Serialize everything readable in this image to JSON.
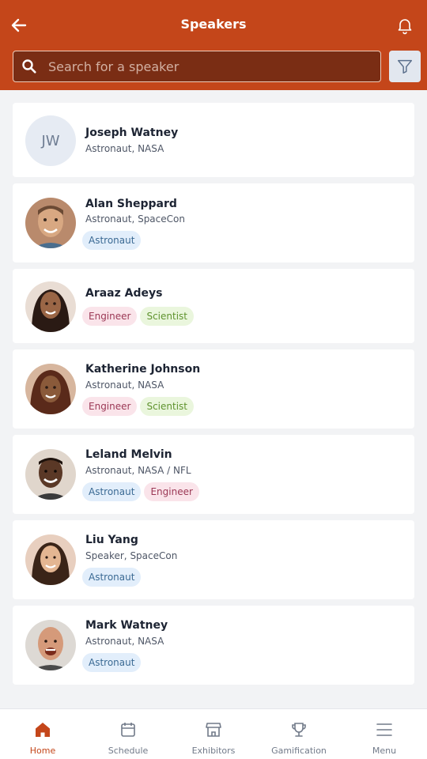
{
  "header": {
    "title": "Speakers"
  },
  "search": {
    "placeholder": "Search for a speaker",
    "value": ""
  },
  "colors": {
    "brand": "#c4461a",
    "astronaut": "#3b6a94",
    "engineer": "#9b3855",
    "scientist": "#5f932e"
  },
  "speakers": [
    {
      "name": "Joseph Watney",
      "role": "Astronaut, NASA",
      "initials": "JW",
      "tags": []
    },
    {
      "name": "Alan Sheppard",
      "role": "Astronaut, SpaceCon",
      "tags": [
        "Astronaut"
      ]
    },
    {
      "name": "Araaz Adeys",
      "role": "",
      "tags": [
        "Engineer",
        "Scientist"
      ]
    },
    {
      "name": "Katherine Johnson",
      "role": "Astronaut, NASA",
      "tags": [
        "Engineer",
        "Scientist"
      ]
    },
    {
      "name": "Leland Melvin",
      "role": "Astronaut, NASA / NFL",
      "tags": [
        "Astronaut",
        "Engineer"
      ]
    },
    {
      "name": "Liu Yang",
      "role": "Speaker, SpaceCon",
      "tags": [
        "Astronaut"
      ]
    },
    {
      "name": "Mark Watney",
      "role": "Astronaut, NASA",
      "tags": [
        "Astronaut"
      ]
    }
  ],
  "tabs": [
    {
      "label": "Home",
      "icon": "home-icon",
      "active": true
    },
    {
      "label": "Schedule",
      "icon": "calendar-icon",
      "active": false
    },
    {
      "label": "Exhibitors",
      "icon": "store-icon",
      "active": false
    },
    {
      "label": "Gamification",
      "icon": "trophy-icon",
      "active": false
    },
    {
      "label": "Menu",
      "icon": "menu-icon",
      "active": false
    }
  ]
}
